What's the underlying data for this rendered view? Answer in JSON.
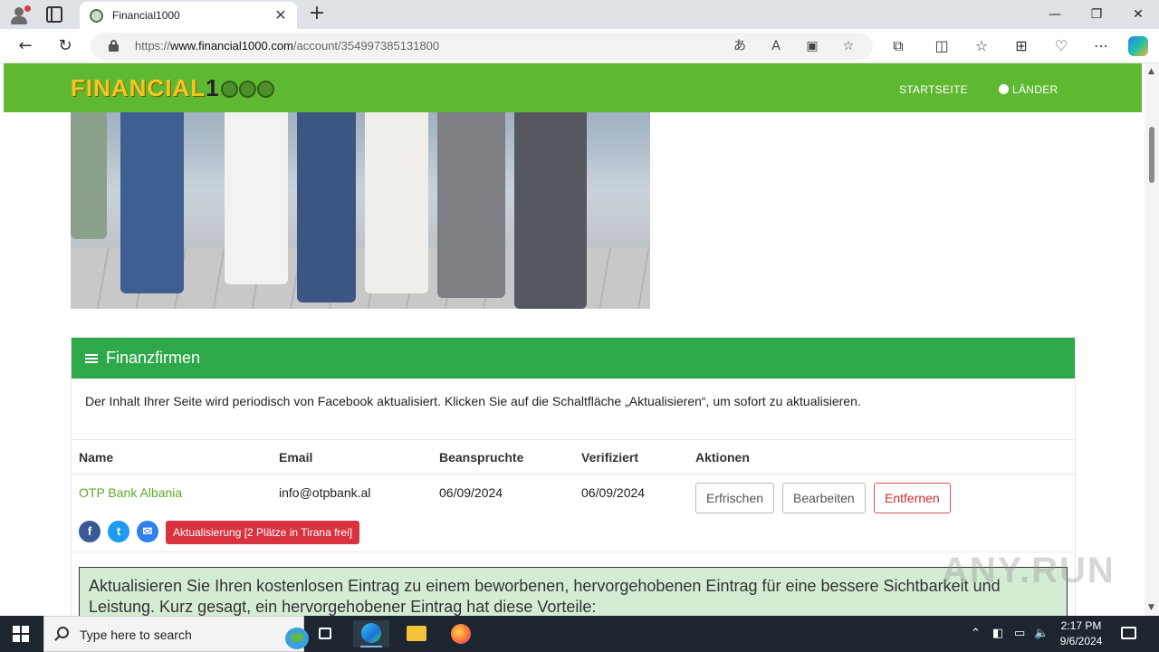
{
  "browser": {
    "tab_title": "Financial1000",
    "url_prefix": "https://",
    "url_host": "www.financial1000.com",
    "url_path": "/account/354997385131800"
  },
  "site": {
    "logo_text": "FINANCIAL",
    "logo_digit": "1",
    "nav": {
      "home": "STARTSEITE",
      "countries": "LÄNDER"
    }
  },
  "panel": {
    "title": "Finanzfirmen",
    "notice": "Der Inhalt Ihrer Seite wird periodisch von Facebook aktualisiert. Klicken Sie auf die Schaltfläche „Aktualisieren“, um sofort zu aktualisieren.",
    "columns": [
      "Name",
      "Email",
      "Beanspruchte",
      "Verifiziert",
      "Aktionen"
    ],
    "row": {
      "name": "OTP Bank Albania",
      "email": "info@otpbank.al",
      "claimed": "06/09/2024",
      "verified": "06/09/2024"
    },
    "actions": {
      "refresh": "Erfrischen",
      "edit": "Bearbeiten",
      "remove": "Entfernen"
    },
    "update_label": "Aktualisierung [2 Plätze in Tirana frei]",
    "promo": "Aktualisieren Sie Ihren kostenlosen Eintrag zu einem beworbenen, hervorgehobenen Eintrag für eine bessere Sichtbarkeit und Leistung. Kurz gesagt, ein hervorgehobener Eintrag hat diese Vorteile:"
  },
  "watermark": "ANY.RUN",
  "taskbar": {
    "search_placeholder": "Type here to search",
    "time": "2:17 PM",
    "date": "9/6/2024"
  },
  "colors": {
    "site_nav": "#5fb831",
    "panel_header": "#2ea84a",
    "danger": "#d9333f",
    "link_green": "#5fa82f"
  }
}
